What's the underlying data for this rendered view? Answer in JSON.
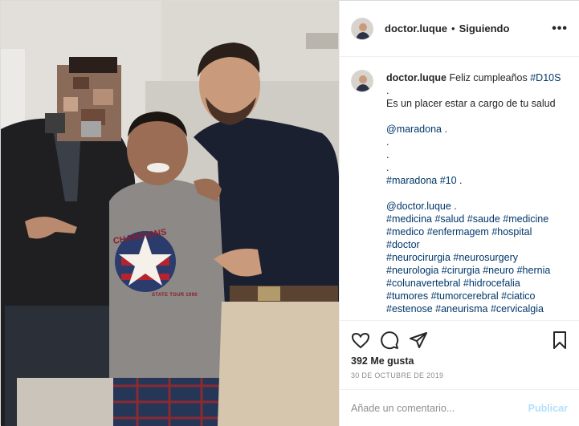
{
  "post": {
    "username": "doctor.luque",
    "separator": "•",
    "follow_status": "Siguiendo",
    "more_label": "•••",
    "caption_lines": [
      {
        "parts": [
          {
            "t": "Feliz cumpleaños ",
            "c": ""
          },
          {
            "t": "#D10S",
            "c": "link"
          }
        ]
      },
      {
        "parts": [
          {
            "t": ".",
            "c": ""
          }
        ]
      },
      {
        "parts": [
          {
            "t": "Es un placer estar a cargo de tu salud",
            "c": ""
          }
        ]
      },
      {
        "parts": [
          {
            "t": "",
            "c": ""
          }
        ]
      },
      {
        "parts": [
          {
            "t": "@maradona",
            "c": "link"
          },
          {
            "t": " .",
            "c": ""
          }
        ]
      },
      {
        "parts": [
          {
            "t": ".",
            "c": ""
          }
        ]
      },
      {
        "parts": [
          {
            "t": ".",
            "c": ""
          }
        ]
      },
      {
        "parts": [
          {
            "t": ".",
            "c": ""
          }
        ]
      },
      {
        "parts": [
          {
            "t": "#maradona #10",
            "c": "link"
          },
          {
            "t": " .",
            "c": ""
          }
        ]
      },
      {
        "parts": [
          {
            "t": "",
            "c": ""
          }
        ]
      },
      {
        "parts": [
          {
            "t": "@doctor.luque",
            "c": "link"
          },
          {
            "t": " .",
            "c": ""
          }
        ]
      },
      {
        "parts": [
          {
            "t": "#medicina #salud #saude #medicine",
            "c": "link"
          }
        ]
      },
      {
        "parts": [
          {
            "t": "#medico #enfermagem #hospital",
            "c": "link"
          }
        ]
      },
      {
        "parts": [
          {
            "t": "#doctor",
            "c": "link"
          }
        ]
      },
      {
        "parts": [
          {
            "t": "#neurocirurgia #neurosurgery",
            "c": "link"
          }
        ]
      },
      {
        "parts": [
          {
            "t": "#neurologia #cirurgia #neuro #hernia",
            "c": "link"
          }
        ]
      },
      {
        "parts": [
          {
            "t": "#colunavertebral #hidrocefalia",
            "c": "link"
          }
        ]
      },
      {
        "parts": [
          {
            "t": "#tumores #tumorcerebral #ciatico",
            "c": "link"
          }
        ]
      },
      {
        "parts": [
          {
            "t": "#estenose #aneurisma #cervicalgia",
            "c": "link"
          }
        ]
      }
    ],
    "likes": "392 Me gusta",
    "date": "30 DE OCTUBRE DE 2019",
    "comment_placeholder": "Añade un comentario...",
    "publish_label": "Publicar",
    "shirt_text": "STATE TOUR 1990"
  },
  "icons": {
    "like": "heart-icon",
    "comment": "comment-bubble-icon",
    "share": "paper-plane-icon",
    "save": "bookmark-icon",
    "more": "ellipsis-icon"
  },
  "colors": {
    "link": "#00376b",
    "muted": "#8e8e8e",
    "publish_disabled": "#b2dffc",
    "border": "#dbdbdb"
  }
}
